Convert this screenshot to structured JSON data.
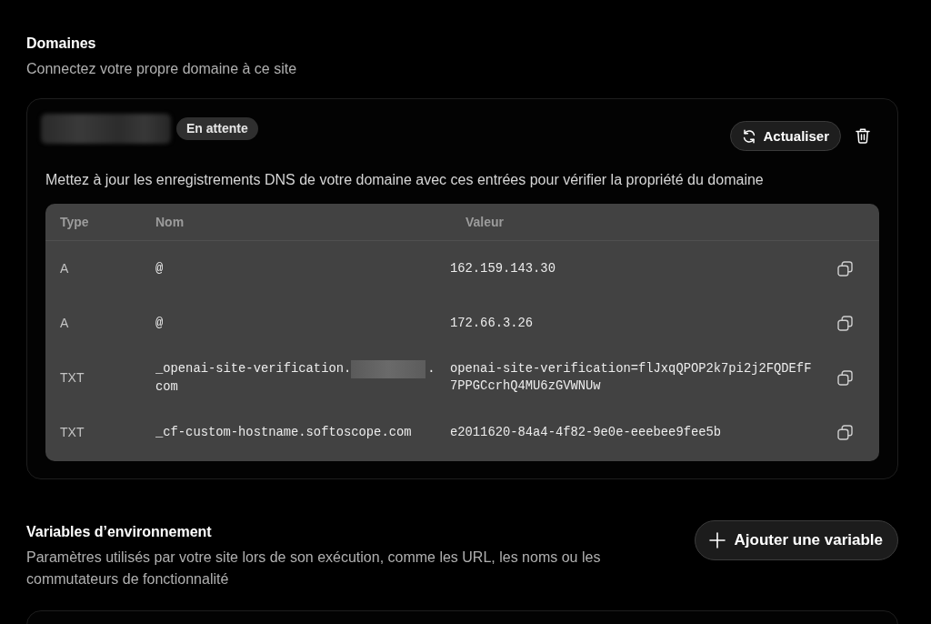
{
  "domains": {
    "title": "Domaines",
    "subtitle": "Connectez votre propre domaine à ce site",
    "domain": {
      "name_parts": [
        {
          "kind": "redacted"
        }
      ],
      "status": "En attente",
      "refresh_button": "Actualiser"
    },
    "instructions": "Mettez à jour les enregistrements DNS de votre domaine avec ces entrées pour vérifier la propriété du domaine",
    "table": {
      "columns": [
        "Type",
        "Nom",
        "Valeur"
      ],
      "rows": [
        {
          "type": "A",
          "name_parts": [
            {
              "kind": "text",
              "text": "@"
            }
          ],
          "value": "162.159.143.30"
        },
        {
          "type": "A",
          "name_parts": [
            {
              "kind": "text",
              "text": "@"
            }
          ],
          "value": "172.66.3.26"
        },
        {
          "type": "TXT",
          "name_parts": [
            {
              "kind": "text",
              "text": "_openai-site-verification."
            },
            {
              "kind": "redacted"
            },
            {
              "kind": "text",
              "text": "."
            },
            {
              "kind": "text",
              "text": "com"
            }
          ],
          "value": "openai-site-verification=flJxqQPOP2k7pi2j2FQDEfF7PPGCcrhQ4MU6zGVWNUw"
        },
        {
          "type": "TXT",
          "name_parts": [
            {
              "kind": "text",
              "text": "_cf-custom-hostname.softoscope.com"
            }
          ],
          "value": "e2011620-84a4-4f82-9e0e-eeebee9fee5b"
        }
      ]
    }
  },
  "variables": {
    "title": "Variables d’environnement",
    "subtitle": "Paramètres utilisés par votre site lors de son exécution, comme les URL, les noms ou les commutateurs de fonctionnalité",
    "add_button": "Ajouter une variable"
  }
}
